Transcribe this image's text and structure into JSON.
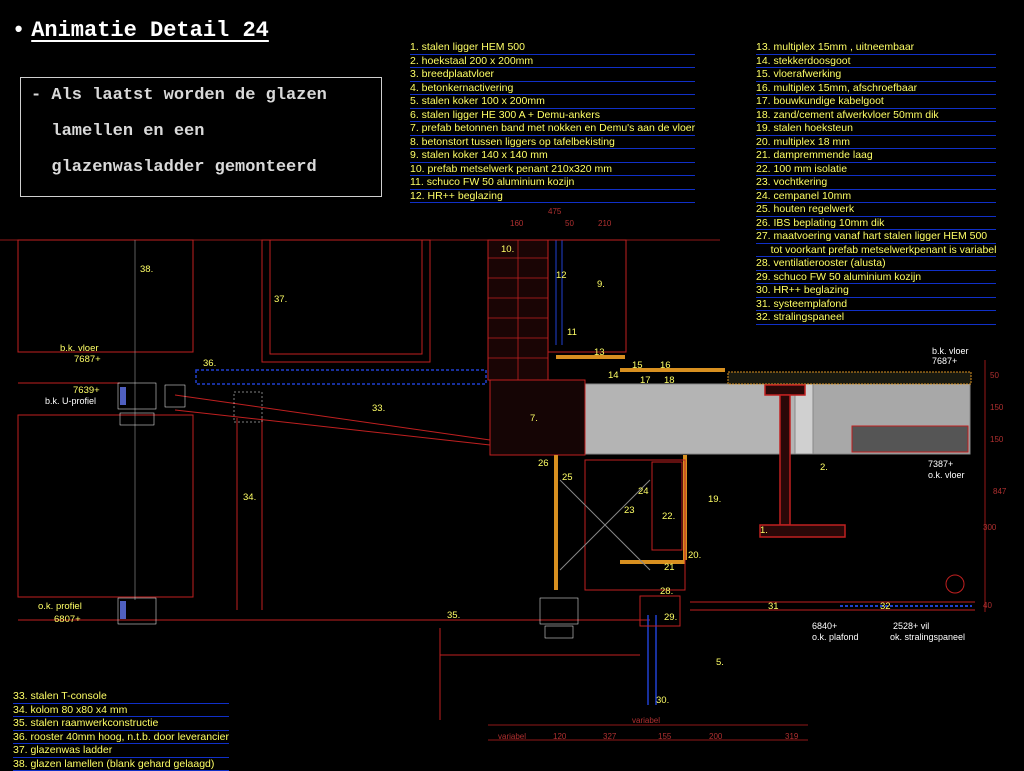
{
  "slide": {
    "bullet": "•",
    "title": "Animatie Detail 24",
    "body_lines": [
      "- Als laatst worden de glazen",
      "  lamellen en een",
      "  glazenwasladder gemonteerd"
    ]
  },
  "legend_top_left": [
    "1. stalen ligger HEM 500",
    "2. hoekstaal 200 x 200mm",
    "3. breedplaatvloer",
    "4. betonkernactivering",
    "5. stalen koker 100 x 200mm",
    "6. stalen ligger HE 300 A + Demu-ankers",
    "7. prefab betonnen band met nokken en Demu's aan de vloer",
    "8. betonstort tussen liggers op tafelbekisting",
    "9. stalen koker 140 x 140 mm",
    "10. prefab metselwerk penant 210x320 mm",
    "11. schuco FW 50 aluminium kozijn",
    "12. HR++ beglazing"
  ],
  "legend_top_right": [
    "13. multiplex 15mm , uitneembaar",
    "14. stekkerdoosgoot",
    "15. vloerafwerking",
    "16. multiplex 15mm, afschroefbaar",
    "17. bouwkundige kabelgoot",
    "18. zand/cement afwerkvloer 50mm dik",
    "19. stalen hoeksteun",
    "20. multiplex 18 mm",
    "21. dampremmende laag",
    "22. 100 mm isolatie",
    "23. vochtkering",
    "24. cempanel 10mm",
    "25. houten regelwerk",
    "26. IBS beplating 10mm dik",
    "27. maatvoering vanaf hart stalen ligger HEM 500",
    "     tot voorkant prefab metselwerkpenant is variabel",
    "28. ventilatierooster (alusta)",
    "29. schuco FW 50 aluminium kozijn",
    "30. HR++ beglazing",
    "31. systeemplafond",
    "32. stralingspaneel"
  ],
  "legend_bottom_left": [
    "33. stalen T-console",
    "34. kolom 80 x80 x4 mm",
    "35. stalen raamwerkconstructie",
    "36. rooster 40mm hoog, n.t.b. door leverancier",
    "37. glazenwas ladder",
    "38. glazen lamellen (blank gehard gelaagd)"
  ],
  "drawing": {
    "callouts": [
      "38.",
      "37.",
      "36.",
      "33.",
      "34.",
      "35.",
      "10.",
      "9.",
      "11",
      "12",
      "13",
      "14",
      "15",
      "16",
      "17",
      "18",
      "7.",
      "26",
      "25",
      "24",
      "23",
      "22.",
      "19.",
      "20.",
      "21",
      "28.",
      "29.",
      "30.",
      "5.",
      "31",
      "32",
      "2.",
      "1."
    ],
    "level_labels": {
      "bk_vloer_left": "b.k. vloer",
      "bk_vloer_left_val": "7687+",
      "bk_uprofiel_val": "7639+",
      "bk_uprofiel": "b.k. U-profiel",
      "ok_profiel": "o.k. profiel",
      "ok_profiel_val": "6807+",
      "bk_vloer_right": "b.k. vloer",
      "bk_vloer_right_val": "7687+",
      "ok_vloer_val": "7387+",
      "ok_vloer": "o.k. vloer",
      "ok_plafond_val": "6840+",
      "ok_plafond": "o.k. plafond",
      "ok_straling_val": "2528+ vil",
      "ok_straling": "ok. stralingspaneel"
    },
    "dims_bottom": [
      "variabel",
      "variabel",
      "120",
      "327",
      "155",
      "200",
      "319"
    ],
    "dims_right": [
      "50",
      "150",
      "150",
      "847",
      "300",
      "40"
    ],
    "dims_top": [
      "475",
      "160",
      "50",
      "210"
    ],
    "colors": {
      "legend_text": "#ffff66",
      "lines_red": "#c02020",
      "concrete": "#b4b4b4",
      "blue_dashed": "#2040d0",
      "orange": "#d89020"
    }
  }
}
